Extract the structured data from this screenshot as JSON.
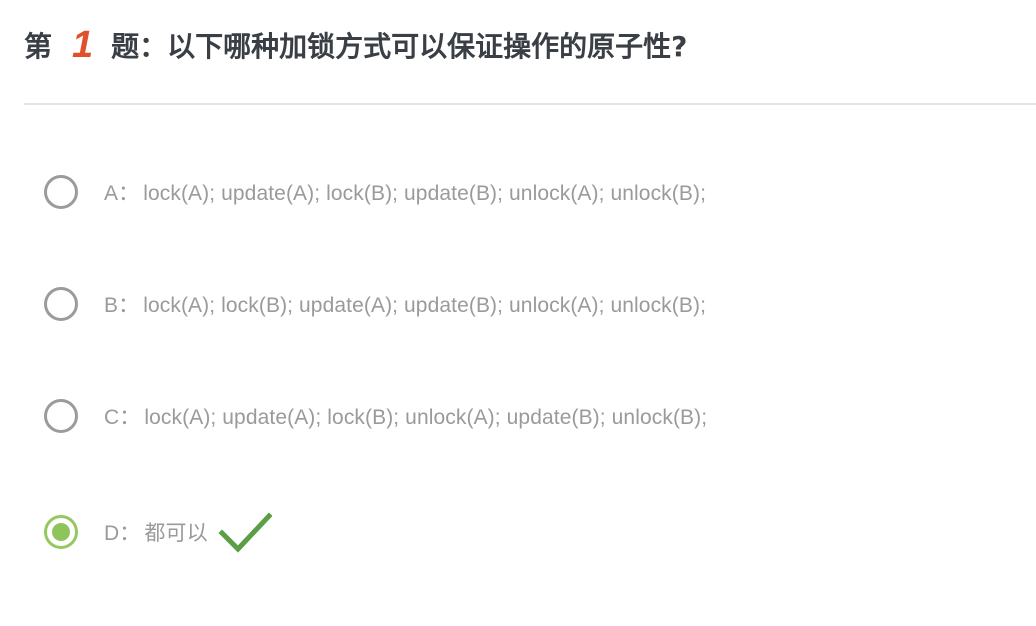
{
  "question": {
    "prefix": "第",
    "number": "1",
    "text": "题：以下哪种加锁方式可以保证操作的原子性?"
  },
  "options": [
    {
      "letter": "A：",
      "text": "lock(A); update(A); lock(B); update(B); unlock(A); unlock(B);",
      "selected": false
    },
    {
      "letter": "B：",
      "text": "lock(A); lock(B); update(A); update(B); unlock(A); unlock(B);",
      "selected": false
    },
    {
      "letter": "C：",
      "text": "lock(A); update(A); lock(B); unlock(A); update(B); unlock(B);",
      "selected": false
    },
    {
      "letter": "D：",
      "text": "都可以",
      "selected": true,
      "correct_mark": "checkmark-icon"
    }
  ],
  "colors": {
    "question_number": "#e0502a",
    "selected_radio": "#95c85f",
    "checkmark": "#5a9e45",
    "option_text": "#9a9a9a"
  }
}
